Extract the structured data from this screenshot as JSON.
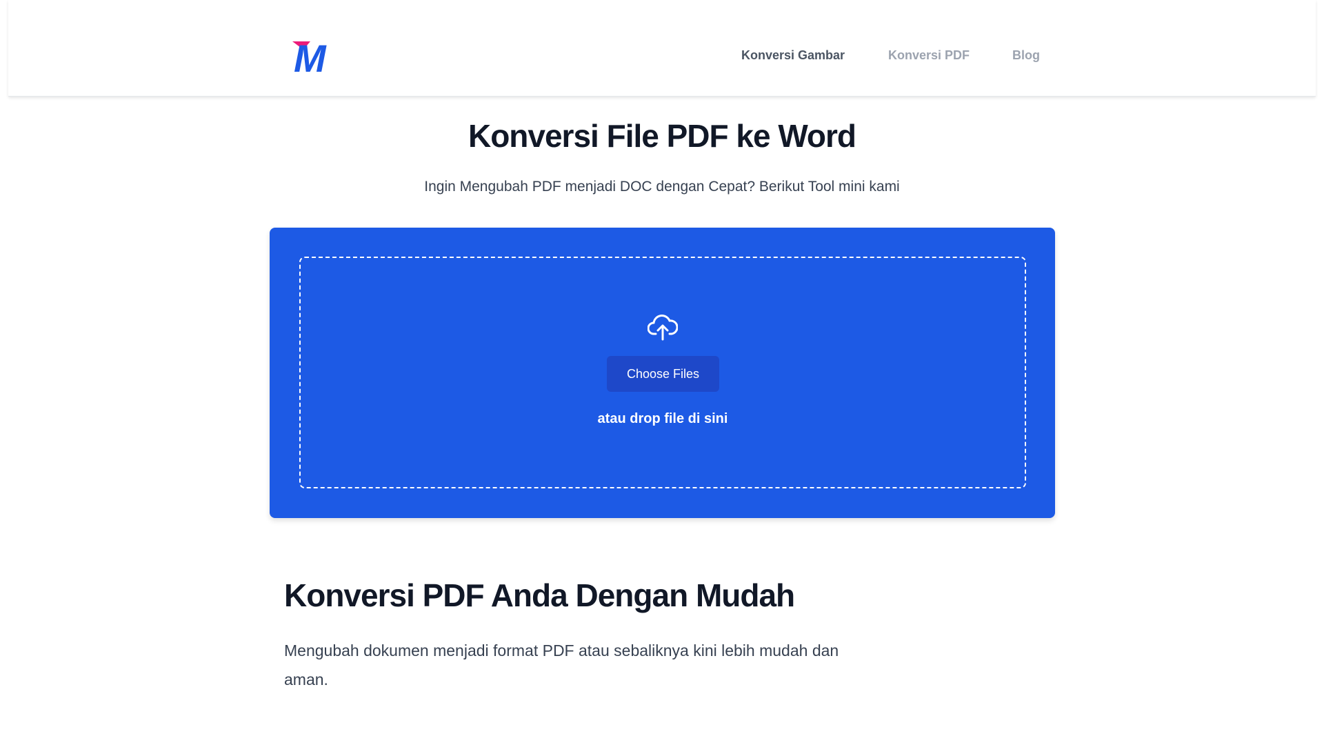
{
  "header": {
    "logo": {
      "letter": "M",
      "brand_color": "#1d5ae5",
      "accent_color": "#ec1c7a"
    },
    "nav": [
      {
        "label": "Konversi Gambar",
        "active": true
      },
      {
        "label": "Konversi PDF",
        "active": false
      },
      {
        "label": "Blog",
        "active": false
      }
    ]
  },
  "hero": {
    "title": "Konversi File PDF ke Word",
    "subtitle": "Ingin Mengubah PDF menjadi DOC dengan Cepat? Berikut Tool mini kami"
  },
  "upload": {
    "icon": "cloud-upload-icon",
    "button_label": "Choose Files",
    "drop_text": "atau drop file di sini",
    "card_color": "#1d5ae5",
    "button_color": "#1e48c9"
  },
  "content": {
    "section_title": "Konversi PDF Anda Dengan Mudah",
    "section_body": "Mengubah dokumen menjadi format PDF atau sebaliknya kini lebih mudah dan aman."
  }
}
